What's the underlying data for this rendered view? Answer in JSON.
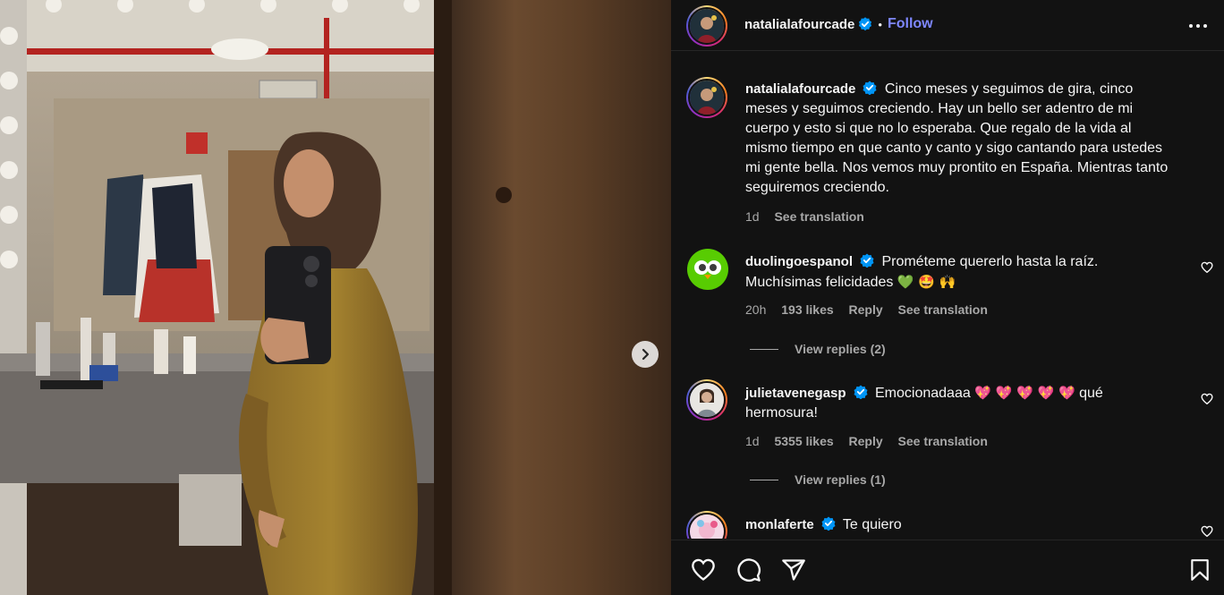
{
  "post": {
    "username": "natalialafourcade",
    "dot": "•",
    "follow_label": "Follow",
    "caption": "Cinco meses y seguimos de gira, cinco meses y seguimos creciendo. Hay un bello ser adentro de mi cuerpo y esto si que no lo esperaba. Que regalo de la vida al mismo tiempo en que canto y canto y sigo cantando para ustedes mi gente bella. Nos vemos muy prontito en España. Mientras tanto seguiremos creciendo.",
    "time": "1d",
    "see_translation": "See translation"
  },
  "comments": [
    {
      "username": "duolingoespanol",
      "text": "Prométeme quererlo hasta la raíz. Muchísimas felicidades",
      "emojis": "💚 🤩 🙌",
      "time": "20h",
      "likes": "193 likes",
      "reply": "Reply",
      "see_translation": "See translation",
      "view_replies": "View replies (2)"
    },
    {
      "username": "julietavenegasp",
      "text": "Emocionadaaa",
      "emojis": "💖 💖 💖 💖 💖",
      "text_after": "qué hermosura!",
      "time": "1d",
      "likes": "5355 likes",
      "reply": "Reply",
      "see_translation": "See translation",
      "view_replies": "View replies (1)"
    },
    {
      "username": "monlaferte",
      "text": "Te quiero"
    }
  ],
  "icons": {
    "verified": "verified-badge-icon",
    "more": "more-options-icon",
    "heart": "heart-icon",
    "comment": "comment-icon",
    "share": "share-icon",
    "save": "bookmark-icon",
    "next": "chevron-right-icon"
  },
  "colors": {
    "panel_bg": "#121212",
    "follow": "#7e87ff",
    "verified": "#0095f6",
    "muted": "#a8a8a8"
  }
}
